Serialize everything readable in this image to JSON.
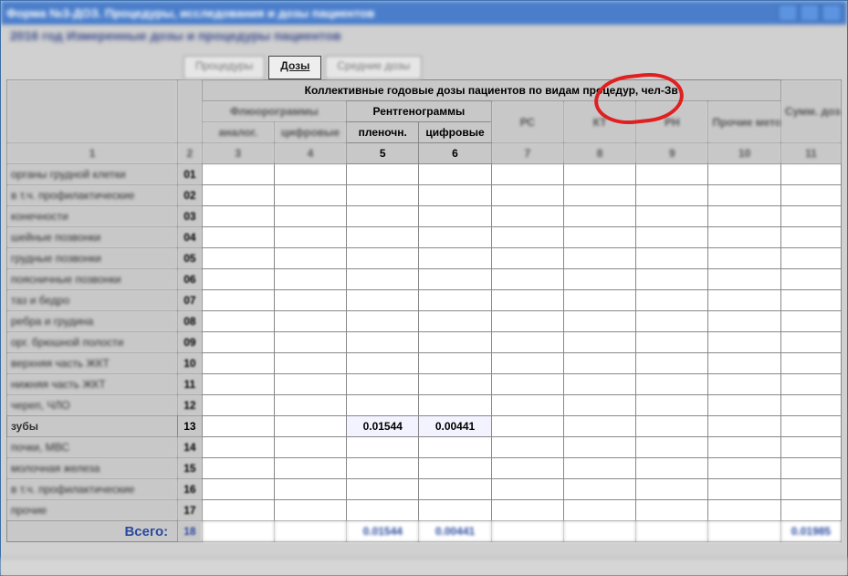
{
  "window": {
    "title": "Форма №3-ДОЗ. Процедуры, исследования и дозы пациентов"
  },
  "subheader": "2016 год   Измеренные дозы и процедуры пациентов",
  "tabs": {
    "t1": "Процедуры",
    "t2": "Дозы",
    "t3": "Средние дозы"
  },
  "header": {
    "main": "Коллективные годовые дозы пациентов по видам процедур, чел-Зв",
    "group_fg": "Флюорограммы",
    "group_rg": "Рентгенограммы",
    "fg_a": "аналог.",
    "fg_d": "цифровые",
    "rg_a": "пленочн.",
    "rg_b": "цифровые",
    "c7": "РС",
    "c8": "КТ",
    "c9": "РН",
    "c10": "Прочие методы",
    "sum": "Сумм. доза, чел-Зв",
    "n1": "1",
    "n2": "2",
    "n3": "3",
    "n4": "4",
    "n5": "5",
    "n6": "6",
    "n7": "7",
    "n8": "8",
    "n9": "9",
    "n10": "10",
    "n11": "11"
  },
  "rows": {
    "r1": {
      "label": "органы грудной клетки",
      "num": "01"
    },
    "r2": {
      "label": "в т.ч. профилактические",
      "num": "02"
    },
    "r3": {
      "label": "конечности",
      "num": "03"
    },
    "r4": {
      "label": "шейные позвонки",
      "num": "04"
    },
    "r5": {
      "label": "грудные позвонки",
      "num": "05"
    },
    "r6": {
      "label": "поясничные позвонки",
      "num": "06"
    },
    "r7": {
      "label": "таз и бедро",
      "num": "07"
    },
    "r8": {
      "label": "ребра и грудина",
      "num": "08"
    },
    "r9": {
      "label": "орг. брюшной полости",
      "num": "09"
    },
    "r10": {
      "label": "верхняя часть ЖКТ",
      "num": "10"
    },
    "r11": {
      "label": "нижняя часть ЖКТ",
      "num": "11"
    },
    "r12": {
      "label": "череп, ЧЛО",
      "num": "12"
    },
    "r13": {
      "label": "зубы",
      "num": "13",
      "c5": "0.01544",
      "c6": "0.00441"
    },
    "r14": {
      "label": "почки, МВС",
      "num": "14"
    },
    "r15": {
      "label": "молочная железа",
      "num": "15"
    },
    "r16": {
      "label": "в т.ч. профилактические",
      "num": "16"
    },
    "r17": {
      "label": "прочие",
      "num": "17"
    }
  },
  "total": {
    "label": "Всего:",
    "num": "18",
    "c5": "0.01544",
    "c6": "0.00441",
    "c11": "0.01985"
  }
}
